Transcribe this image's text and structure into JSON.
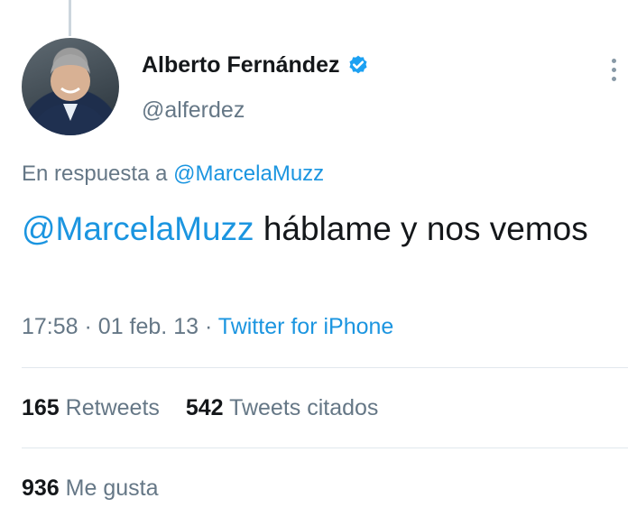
{
  "tweet": {
    "author_name": "Alberto Fernández",
    "author_handle": "@alferdez",
    "reply_prefix": "En respuesta a",
    "reply_to": "@MarcelaMuzz",
    "mention": "@MarcelaMuzz",
    "text": "háblame y nos vemos",
    "time": "17:58",
    "date": "01 feb. 13",
    "separator": "·",
    "source": "Twitter for iPhone"
  },
  "stats": {
    "retweets_count": "165",
    "retweets_label": "Retweets",
    "quotes_count": "542",
    "quotes_label": "Tweets citados",
    "likes_count": "936",
    "likes_label": "Me gusta"
  },
  "colors": {
    "link": "#1b95e0",
    "secondary_text": "#657786",
    "primary_text": "#14171a",
    "verified_badge": "#1da1f2",
    "divider": "#e1e8ed"
  },
  "icons": {
    "verified": "verified-badge-icon",
    "more": "more-options-icon"
  }
}
